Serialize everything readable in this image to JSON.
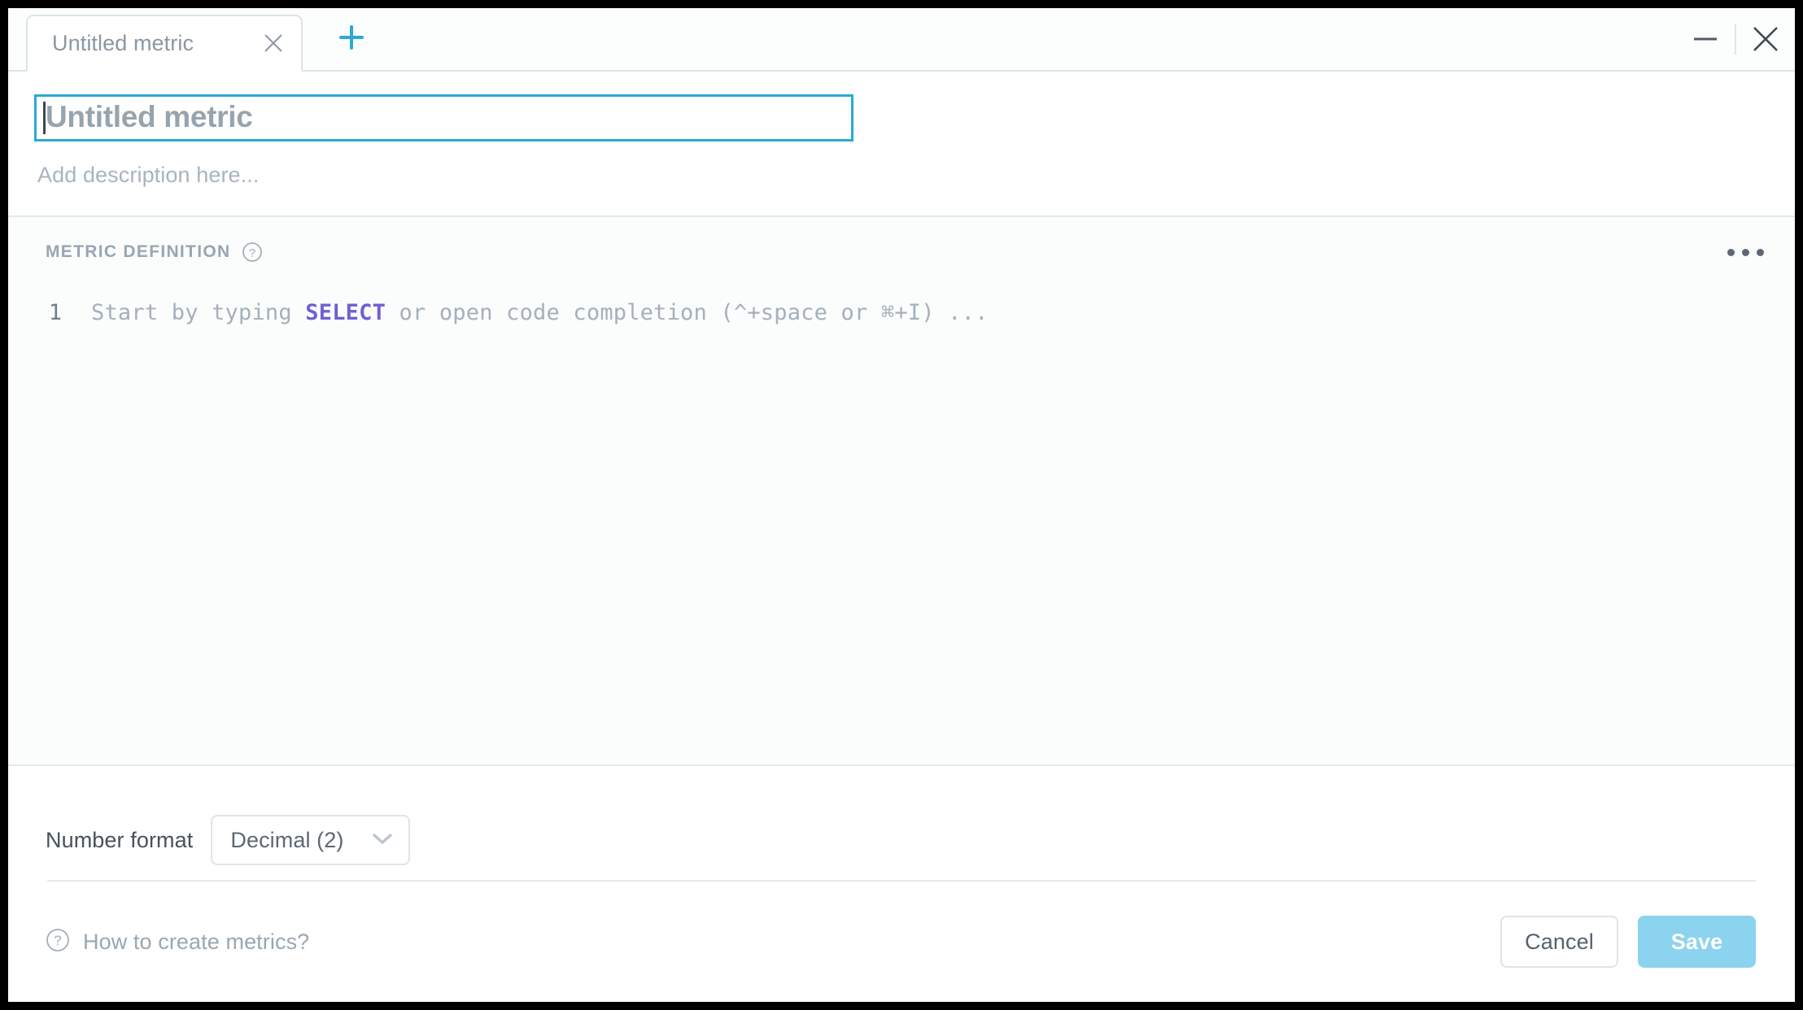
{
  "window": {
    "minimize_label": "minimize",
    "close_label": "close"
  },
  "tabs": {
    "items": [
      {
        "label": "Untitled metric",
        "active": true
      }
    ],
    "add_label": "+",
    "close_label": "×"
  },
  "header": {
    "title_value": "Untitled metric",
    "title_placeholder": "Untitled metric",
    "description_placeholder": "Add description here..."
  },
  "metric_definition": {
    "section_label": "METRIC DEFINITION",
    "help_icon": "question-circle-icon",
    "overflow_icon": "ellipsis-icon",
    "line_number": "1",
    "placeholder_prefix": "Start by typing ",
    "placeholder_keyword": "SELECT",
    "placeholder_suffix": " or open code completion (^+space or ⌘+I) ...",
    "keyword_color": "#6f5fd1"
  },
  "number_format": {
    "label": "Number format",
    "selected": "Decimal (2)",
    "chevron_icon": "chevron-down-icon"
  },
  "footer": {
    "help_icon": "question-circle-icon",
    "help_link": "How to create metrics?",
    "cancel_label": "Cancel",
    "save_label": "Save",
    "save_color": "#8bd3ee"
  },
  "colors": {
    "accent": "#29aad4",
    "add_tab": "#29aad4",
    "muted_text": "#98a6b2"
  }
}
